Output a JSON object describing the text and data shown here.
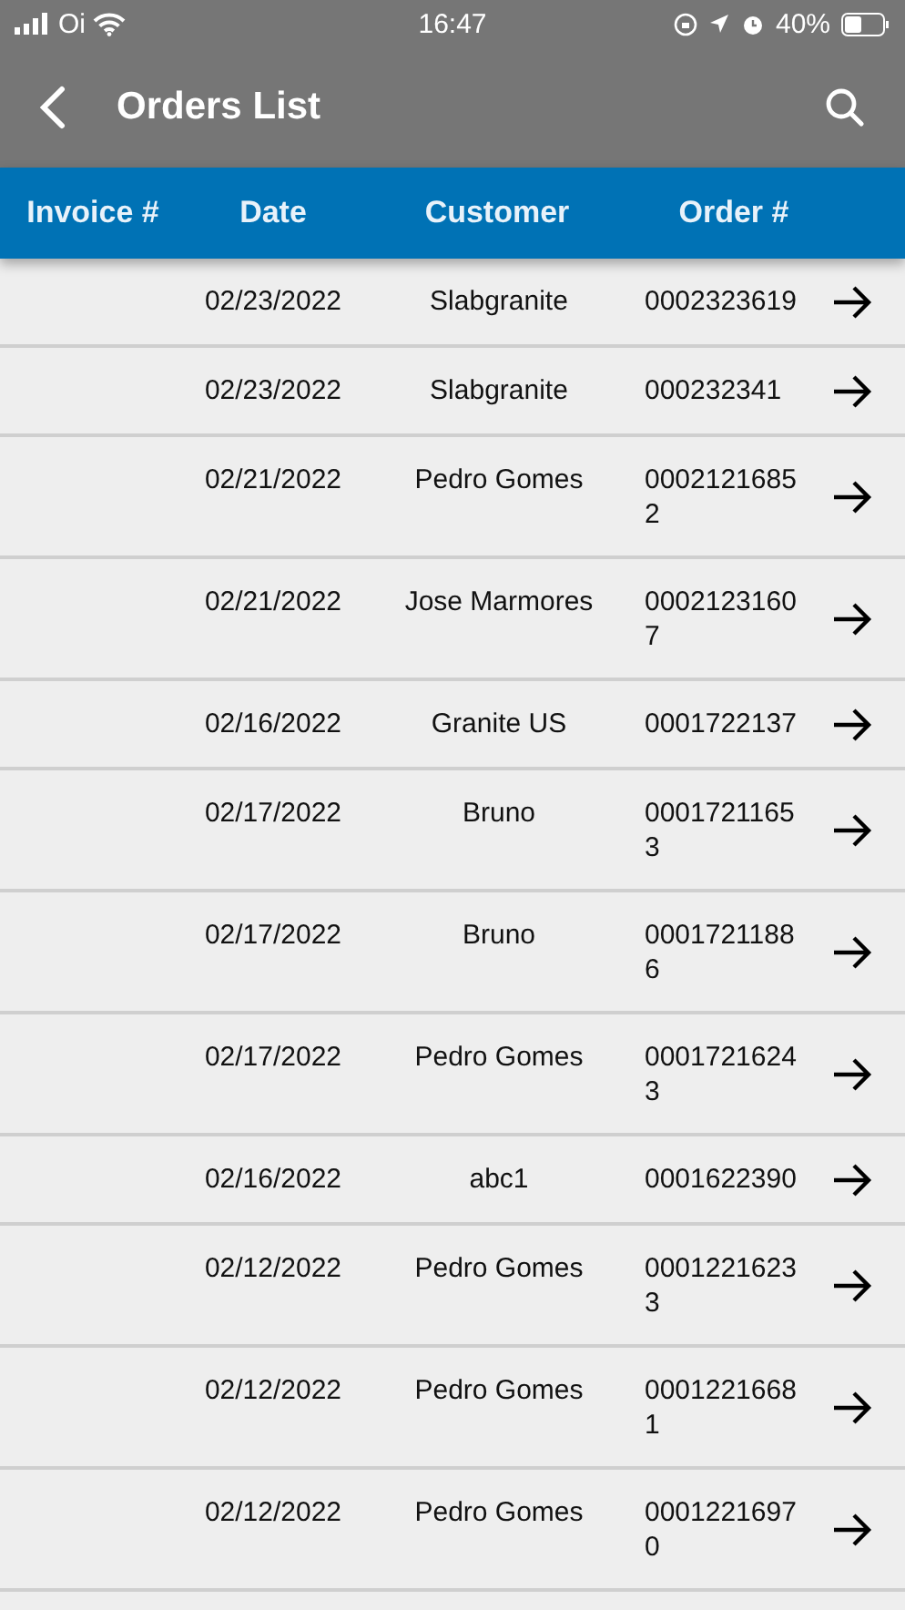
{
  "status_bar": {
    "carrier": "Oi",
    "time": "16:47",
    "battery_percent": "40%"
  },
  "nav_bar": {
    "title": "Orders List"
  },
  "table": {
    "columns": [
      "Invoice #",
      "Date",
      "Customer",
      "Order #"
    ],
    "rows": [
      {
        "invoice": "",
        "date": "02/23/2022",
        "customer": "Slabgranite",
        "order": "0002323619"
      },
      {
        "invoice": "",
        "date": "02/23/2022",
        "customer": "Slabgranite",
        "order": "000232341"
      },
      {
        "invoice": "",
        "date": "02/21/2022",
        "customer": "Pedro Gomes",
        "order": "00021216852"
      },
      {
        "invoice": "",
        "date": "02/21/2022",
        "customer": "Jose Marmores",
        "order": "00021231607"
      },
      {
        "invoice": "",
        "date": "02/16/2022",
        "customer": "Granite US",
        "order": "0001722137"
      },
      {
        "invoice": "",
        "date": "02/17/2022",
        "customer": "Bruno",
        "order": "00017211653"
      },
      {
        "invoice": "",
        "date": "02/17/2022",
        "customer": "Bruno",
        "order": "00017211886"
      },
      {
        "invoice": "",
        "date": "02/17/2022",
        "customer": "Pedro Gomes",
        "order": "00017216243"
      },
      {
        "invoice": "",
        "date": "02/16/2022",
        "customer": "abc1",
        "order": "0001622390"
      },
      {
        "invoice": "",
        "date": "02/12/2022",
        "customer": "Pedro Gomes",
        "order": "00012216233"
      },
      {
        "invoice": "",
        "date": "02/12/2022",
        "customer": "Pedro Gomes",
        "order": "00012216681"
      },
      {
        "invoice": "",
        "date": "02/12/2022",
        "customer": "Pedro Gomes",
        "order": "00012216970"
      }
    ]
  }
}
